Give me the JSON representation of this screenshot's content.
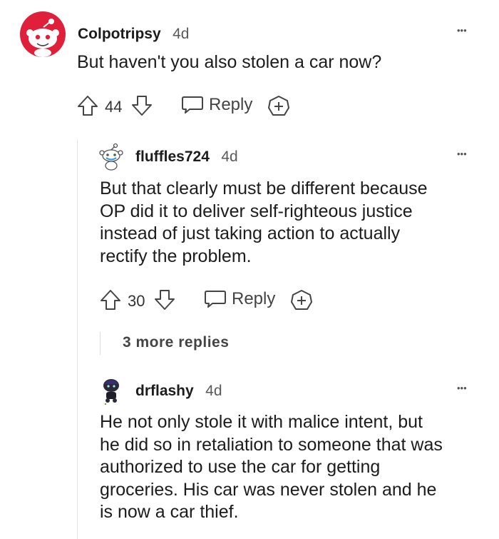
{
  "comments": [
    {
      "username": "Colpotripsy",
      "age": "4d",
      "body": "But haven't you also stolen a car now?",
      "votes": "44",
      "reply_label": "Reply",
      "more_label": "•••"
    },
    {
      "username": "fluffles724",
      "age": "4d",
      "body_lines": [
        "But that clearly must be different because",
        "OP did it to deliver self-righteous justice",
        "instead of just taking action to actually",
        "rectify the problem."
      ],
      "votes": "30",
      "reply_label": "Reply",
      "more_label": "•••",
      "more_replies": "3 more replies"
    },
    {
      "username": "drflashy",
      "age": "4d",
      "body_lines": [
        "He not only stole it with malice intent, but",
        "he did so in retaliation to someone that was",
        "authorized to use the car for getting",
        "groceries. His car was never stolen and he",
        "is now a car thief."
      ],
      "more_label": "•••"
    }
  ]
}
